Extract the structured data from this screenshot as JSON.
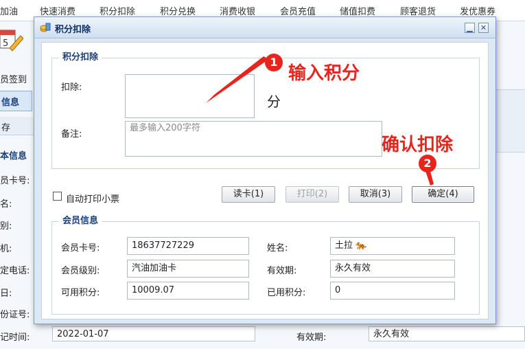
{
  "topmenu": [
    "加油",
    "快速消费",
    "积分扣除",
    "积分兑换",
    "消费收银",
    "会员充值",
    "储值扣费",
    "顾客退货",
    "发优惠券"
  ],
  "background": {
    "signin_label": "员签到",
    "tab_label": "信息",
    "toolbar_label": "存",
    "section_label": "本信息",
    "labels": [
      "员卡号:",
      "名:",
      "别:",
      "机:",
      "定电话:",
      "日:",
      "份证号:",
      "记时间:"
    ],
    "register_date": "2022-01-07",
    "validity_label": "有效期:",
    "validity_value": "永久有效"
  },
  "dialog": {
    "title": "积分扣除",
    "minimize": "▁",
    "close": "✕",
    "deduct_group": {
      "legend": "积分扣除",
      "deduct_label": "扣除:",
      "deduct_value": "",
      "unit": "分",
      "note_label": "备注:",
      "note_placeholder": "最多输入200字符"
    },
    "auto_print_label": "自动打印小票",
    "buttons": {
      "read_card": "读卡(1)",
      "print": "打印(2)",
      "cancel": "取消(3)",
      "confirm": "确定(4)"
    },
    "member_group": {
      "legend": "会员信息",
      "card_no_label": "会员卡号:",
      "card_no": "18637727229",
      "name_label": "姓名:",
      "name": "土拉 🐅",
      "level_label": "会员级别:",
      "level": "汽油加油卡",
      "validity_label": "有效期:",
      "validity": "永久有效",
      "available_label": "可用积分:",
      "available": "10009.07",
      "used_label": "已用积分:",
      "used": "0"
    }
  },
  "annotations": {
    "step1_number": "1",
    "step1_text": "输入积分",
    "step2_number": "2",
    "step2_text": "确认扣除"
  },
  "colors": {
    "annotation_red": "#e8251d",
    "legend_blue": "#1b3f78"
  }
}
